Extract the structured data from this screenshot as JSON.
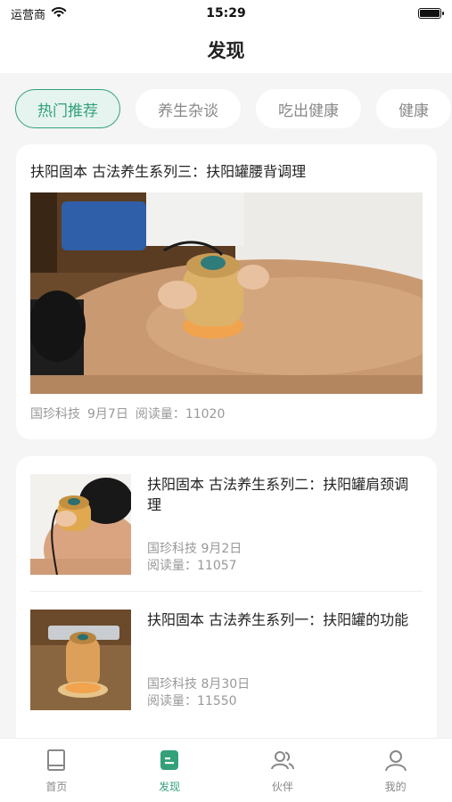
{
  "status_bar": {
    "carrier": "运营商",
    "time": "15:29",
    "battery_level": 1.0
  },
  "nav": {
    "title": "发现"
  },
  "category_tabs": [
    {
      "label": "热门推荐",
      "active": true
    },
    {
      "label": "养生杂谈",
      "active": false
    },
    {
      "label": "吃出健康",
      "active": false
    },
    {
      "label": "健康",
      "active": false
    }
  ],
  "featured_article": {
    "title": "扶阳固本 古法养生系列三：扶阳罐腰背调理",
    "author": "国珍科技",
    "date": "9月7日",
    "reads": "阅读量：11020"
  },
  "articles": [
    {
      "title": "扶阳固本 古法养生系列二：扶阳罐肩颈调理",
      "author": "国珍科技",
      "date": "9月2日",
      "reads": "阅读量：11057"
    },
    {
      "title": "扶阳固本 古法养生系列一：扶阳罐的功能",
      "author": "国珍科技",
      "date": "8月30日",
      "reads": "阅读量：11550"
    }
  ],
  "tab_bar": [
    {
      "label": "首页",
      "icon": "home-icon",
      "active": false
    },
    {
      "label": "发现",
      "icon": "discover-icon",
      "active": true
    },
    {
      "label": "伙伴",
      "icon": "partners-icon",
      "active": false
    },
    {
      "label": "我的",
      "icon": "profile-icon",
      "active": false
    }
  ],
  "colors": {
    "accent": "#33a07a",
    "accent_bg": "#e6f4ef",
    "muted_text": "#999999",
    "page_bg": "#f5f5f5"
  }
}
